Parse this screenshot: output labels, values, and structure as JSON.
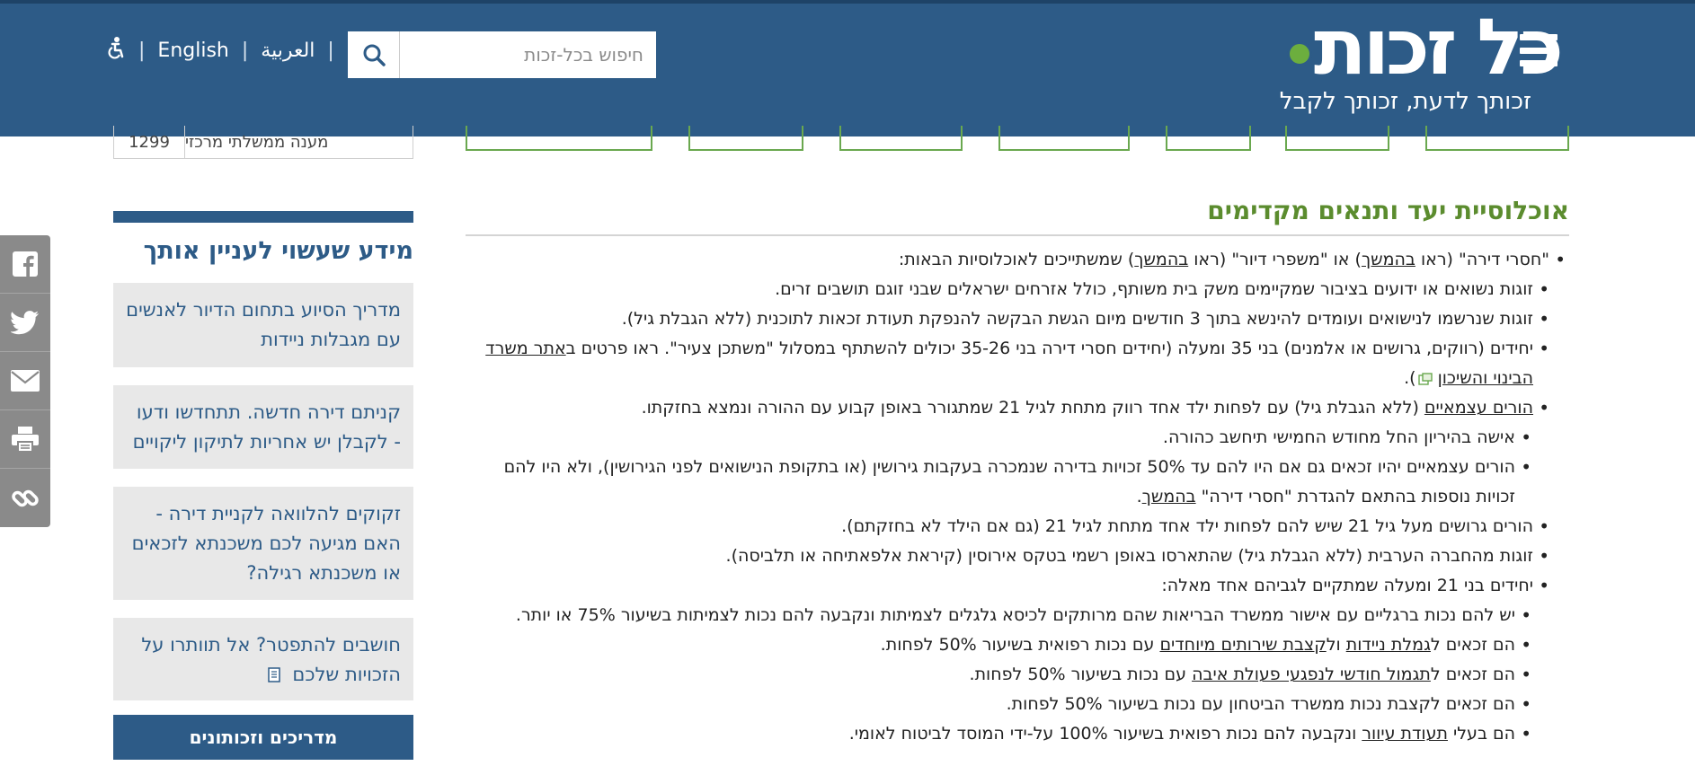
{
  "header": {
    "logo": "כל זכות",
    "tagline": "זכותך לדעת, זכותך לקבל",
    "menu_icon": "hamburger-menu-icon",
    "search_placeholder": "חיפוש בכל-זכות",
    "lang_arabic": "العربية",
    "lang_english": "English",
    "sep": "|",
    "accessibility_icon": "accessibility-icon",
    "brand_color": "#2d5b87"
  },
  "social": {
    "items": [
      "facebook-icon",
      "twitter-icon",
      "email-icon",
      "print-icon",
      "link-icon"
    ]
  },
  "remnant": {
    "table_label": "מענה ממשלתי מרכזי",
    "table_value": "1299"
  },
  "sidebar": {
    "title": "מידע שעשוי לעניין אותך",
    "cards": [
      "מדריך הסיוע בתחום הדיור לאנשים עם מגבלות ניידות",
      "קניתם דירה חדשה. תתחדשו ודעו - לקבלן יש אחריות לתיקון ליקויים",
      "זקוקים להלוואה לקניית דירה - האם מגיעה לכם משכנתא לזכאים או משכנתא רגילה?",
      "חושבים להתפטר? אל תוותרו על הזכויות שלכם"
    ],
    "guides_button": "מדריכים וזכותונים"
  },
  "main": {
    "title": "אוכלוסיית יעד ותנאים מקדימים",
    "items": {
      "i1_pre": "\"חסרי דירה\" (ראו ",
      "i1_link1": "בהמשך",
      "i1_mid": ") או \"משפרי דיור\" (ראו ",
      "i1_link2": "בהמשך",
      "i1_post": ") שמשתייכים לאוכלוסיות הבאות:",
      "i2": "זוגות נשואים או ידועים בציבור שמקיימים משק בית משותף, כולל אזרחים ישראלים שבני זוגם תושבים זרים.",
      "i3": "זוגות שנרשמו לנישואים ועומדים להינשא בתוך 3 חודשים מיום הגשת הבקשה להנפקת תעודת זכאות לתוכנית (ללא הגבלת גיל).",
      "i4_pre": "יחידים (רווקים, גרושים או אלמנים) בני 35 ומעלה (יחידים חסרי דירה בני 35-26 יכולים להשתתף במסלול \"משתכן צעיר\". ראו פרטים ב",
      "i4_link": "אתר משרד הבינוי והשיכון",
      "i4_post": ").",
      "i5_link": "הורים עצמאיים",
      "i5_post": " (ללא הגבלת גיל) עם לפחות ילד אחד רווק מתחת לגיל 21 שמתגורר באופן קבוע עם ההורה ונמצא בחזקתו.",
      "i6": "אישה בהיריון החל מחודש החמישי תיחשב כהורה.",
      "i7_pre": "הורים עצמאיים יהיו זכאים גם אם היו להם עד 50% זכויות בדירה שנמכרה בעקבות גירושין (או בתקופת הנישואים לפני הגירושין), ולא היו להם זכויות נוספות בהתאם להגדרת \"חסרי דירה\" ",
      "i7_link": "בהמשך",
      "i7_post": ".",
      "i8": "הורים גרושים מעל גיל 21 שיש להם לפחות ילד אחד מתחת לגיל 21 (גם אם הילד לא בחזקתם).",
      "i9": "זוגות מהחברה הערבית (ללא הגבלת גיל) שהתארסו באופן רשמי בטקס אירוסין (קיראת אלפאתיחה או תלביסה).",
      "i10": "יחידים בני 21 ומעלה שמתקיים לגביהם אחד מאלה:",
      "i11": "יש להם נכות ברגליים עם אישור ממשרד הבריאות שהם מרותקים לכיסא גלגלים לצמיתות ונקבעה להם נכות לצמיתות בשיעור 75% או יותר.",
      "i12_pre": "הם זכאים ל",
      "i12_link1": "גמלת ניידות",
      "i12_mid": " ול",
      "i12_link2": "קצבת שירותים מיוחדים",
      "i12_post": " עם נכות רפואית בשיעור 50% לפחות.",
      "i13_pre": "הם זכאים ל",
      "i13_link": "תגמול חודשי לנפגעי פעולת איבה",
      "i13_post": " עם נכות בשיעור 50% לפחות.",
      "i14": "הם זכאים לקצבת נכות ממשרד הביטחון עם נכות בשיעור 50% לפחות.",
      "i15_pre": "הם בעלי ",
      "i15_link": "תעודת עיוור",
      "i15_post": " ונקבעה להם נכות רפואית בשיעור 100% על-ידי המוסד לביטוח לאומי."
    }
  }
}
